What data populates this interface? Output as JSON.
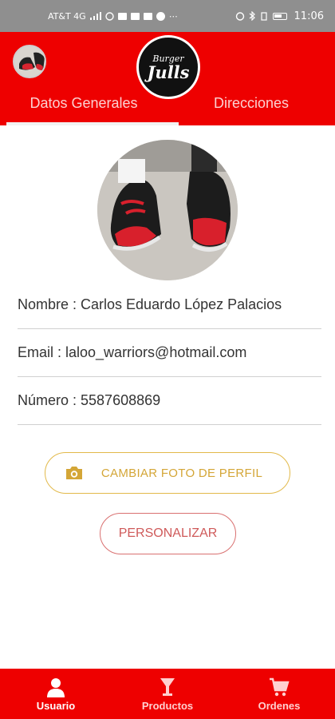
{
  "status_bar": {
    "carrier": "AT&T 4G",
    "time": "11:06",
    "icons": [
      "signal-icon",
      "whatsapp-icon",
      "mail-icon",
      "mail-icon",
      "mail-icon",
      "facebook-icon",
      "more-icon",
      "alarm-icon",
      "bluetooth-icon",
      "vibrate-icon",
      "battery-icon"
    ]
  },
  "header": {
    "logo_top": "Burger",
    "logo_main": "Julls",
    "tabs": [
      {
        "label": "Datos Generales",
        "active": true
      },
      {
        "label": "Direcciones",
        "active": false
      }
    ],
    "color": "#ee0000"
  },
  "profile": {
    "name_row": "Nombre : Carlos Eduardo López Palacios",
    "email_row": "Email : laloo_warriors@hotmail.com",
    "phone_row": "Número : 5587608869"
  },
  "buttons": {
    "change_photo": "CAMBIAR FOTO DE PERFIL",
    "personalize": "PERSONALIZAR",
    "change_photo_color": "#d4a637",
    "personalize_color": "#cf5a5a"
  },
  "bottom_nav": [
    {
      "label": "Usuario",
      "icon": "user-icon",
      "active": true
    },
    {
      "label": "Productos",
      "icon": "drink-icon",
      "active": false
    },
    {
      "label": "Ordenes",
      "icon": "cart-icon",
      "active": false
    }
  ]
}
